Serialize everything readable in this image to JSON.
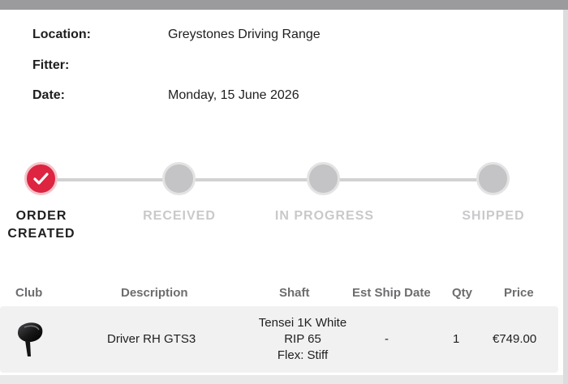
{
  "order": {
    "location_label": "Location:",
    "location_value": "Greystones Driving Range",
    "fitter_label": "Fitter:",
    "fitter_value": "",
    "date_label": "Date:",
    "date_value": "Monday, 15 June 2026"
  },
  "progress": {
    "steps": [
      {
        "line1": "ORDER",
        "line2": "CREATED",
        "state": "completed"
      },
      {
        "line1": "RECEIVED",
        "line2": "",
        "state": "pending"
      },
      {
        "line1": "IN PROGRESS",
        "line2": "",
        "state": "pending"
      },
      {
        "line1": "SHIPPED",
        "line2": "",
        "state": "pending"
      }
    ],
    "active_color": "#dd2440",
    "inactive_color": "#c4c4c6"
  },
  "table": {
    "headers": {
      "club": "Club",
      "description": "Description",
      "shaft": "Shaft",
      "ship_date": "Est Ship Date",
      "qty": "Qty",
      "price": "Price"
    },
    "rows": [
      {
        "club_icon": "golf-driver-icon",
        "description": "Driver RH GTS3",
        "shaft_line1": "Tensei 1K White",
        "shaft_line2": "RIP 65",
        "shaft_line3": "Flex: Stiff",
        "ship_date": "-",
        "qty": "1",
        "price": "€749.00"
      }
    ]
  }
}
